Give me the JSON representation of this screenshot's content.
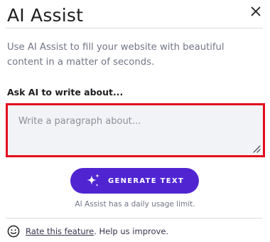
{
  "header": {
    "title": "AI Assist",
    "close_icon": "close-icon"
  },
  "description": "Use AI Assist to fill your website with beautiful content in a matter of seconds.",
  "prompt": {
    "label": "Ask AI to write about...",
    "placeholder": "Write a paragraph about...",
    "value": ""
  },
  "generate_button": {
    "label": "GENERATE TEXT",
    "icon": "sparkles-icon"
  },
  "usage_note": "AI Assist has a daily usage limit.",
  "feedback": {
    "icon": "smiley-icon",
    "link_text": "Rate this feature",
    "suffix_text": ". Help us improve."
  },
  "colors": {
    "accent": "#5025d1",
    "focus_border": "#e2091d",
    "field_bg": "#f2f3f6",
    "muted_text": "#727586"
  }
}
